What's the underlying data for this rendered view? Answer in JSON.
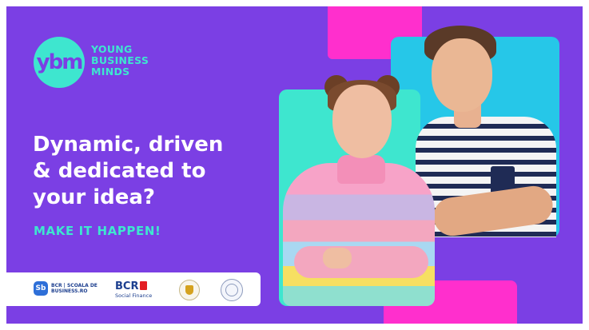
{
  "brand": {
    "mark": "ybm",
    "words": [
      "YOUNG",
      "BUSINESS",
      "MINDS"
    ]
  },
  "headline": {
    "lines": [
      "Dynamic, driven",
      "& dedicated to",
      "your idea?"
    ]
  },
  "cta": "MAKE IT HAPPEN!",
  "sponsors": {
    "scoala_mark": "Sb",
    "scoala_lines": [
      "BCR | SCOALA DE",
      "BUSINESS.RO"
    ],
    "bcr_name": "BCR",
    "bcr_sub": "Social Finance"
  },
  "colors": {
    "background": "#7b3fe4",
    "accent_teal": "#3ee6cf",
    "accent_pink": "#ff2fcd",
    "accent_cyan": "#26c7e8"
  }
}
